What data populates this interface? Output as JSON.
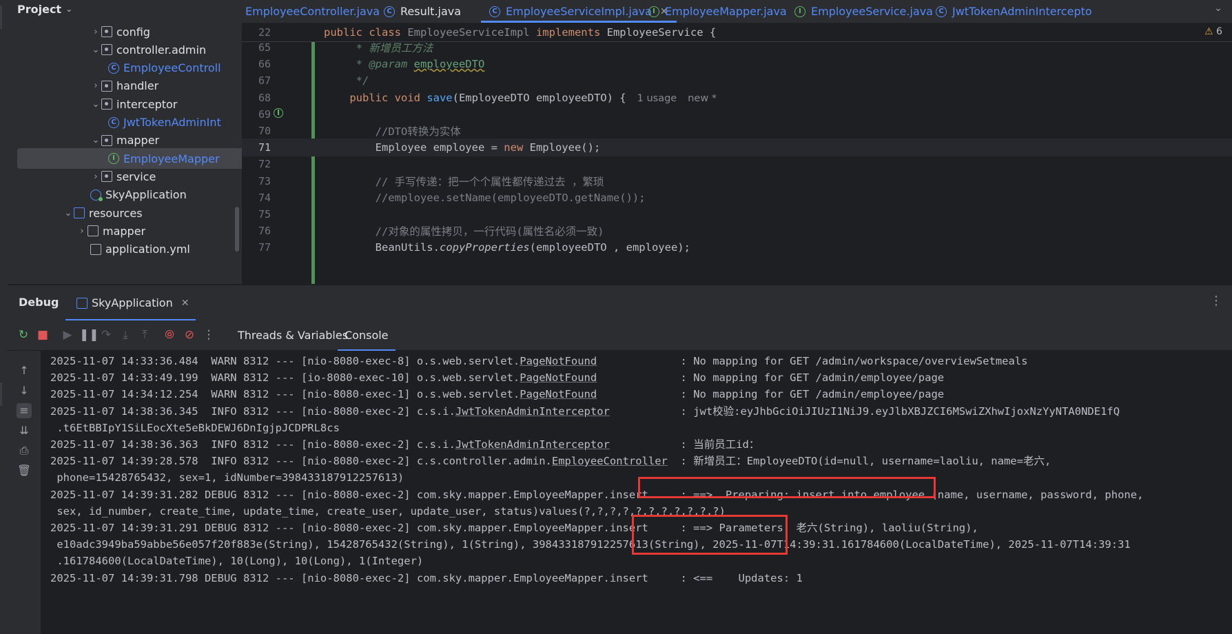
{
  "project": {
    "title": "Project",
    "tree": [
      {
        "label": "config",
        "kind": "package",
        "arrow": "right"
      },
      {
        "label": "controller.admin",
        "kind": "package",
        "arrow": "down"
      },
      {
        "label": "EmployeeControll",
        "kind": "class"
      },
      {
        "label": "handler",
        "kind": "package",
        "arrow": "right"
      },
      {
        "label": "interceptor",
        "kind": "package",
        "arrow": "down"
      },
      {
        "label": "JwtTokenAdminInt",
        "kind": "class"
      },
      {
        "label": "mapper",
        "kind": "package",
        "arrow": "down"
      },
      {
        "label": "EmployeeMapper",
        "kind": "interface",
        "selected": true
      },
      {
        "label": "service",
        "kind": "package",
        "arrow": "right"
      },
      {
        "label": "SkyApplication",
        "kind": "app"
      },
      {
        "label": "resources",
        "kind": "folder-blue",
        "arrow": "down"
      },
      {
        "label": "mapper",
        "kind": "folder",
        "arrow": "right"
      },
      {
        "label": "application.yml",
        "kind": "file"
      }
    ]
  },
  "tabs": [
    {
      "label": "EmployeeController.java",
      "kind": "class"
    },
    {
      "label": "Result.java",
      "kind": "class"
    },
    {
      "label": "EmployeeServiceImpl.java",
      "kind": "class",
      "active": true
    },
    {
      "label": "EmployeeMapper.java",
      "kind": "interface"
    },
    {
      "label": "EmployeeService.java",
      "kind": "interface"
    },
    {
      "label": "JwtTokenAdminIntercepto",
      "kind": "class"
    }
  ],
  "editor": {
    "sticky": {
      "num": "22",
      "kw1": "public class ",
      "name": "EmployeeServiceImpl",
      "kw2": " implements ",
      "iface": "EmployeeService {"
    },
    "warnings": "6",
    "lines": [
      {
        "num": "65",
        "doc": "     * 新增员工方法"
      },
      {
        "num": "66",
        "doc": "     * @param ",
        "param": "employeeDTO"
      },
      {
        "num": "67",
        "doc": "     */"
      },
      {
        "num": "68",
        "kw": "    public void ",
        "fn": "save",
        "rest": "(EmployeeDTO employeeDTO) {",
        "hint1": "1 usage",
        "hint2": "new *"
      },
      {
        "num": "69",
        "rest": ""
      },
      {
        "num": "70",
        "cm": "        //DTO转换为实体"
      },
      {
        "num": "71",
        "rest1": "        Employee employee = ",
        "kw": "new",
        "rest2": " Employee();",
        "current": true
      },
      {
        "num": "72",
        "rest": ""
      },
      {
        "num": "73",
        "cm": "        // 手写传递：把一个个属性都传递过去 ，繁琐"
      },
      {
        "num": "74",
        "cm": "        //employee.setName(employeeDTO.getName());"
      },
      {
        "num": "75",
        "rest": ""
      },
      {
        "num": "76",
        "cm": "        //对象的属性拷贝，一行代码(属性名必须一致)"
      },
      {
        "num": "77",
        "rest1": "        BeanUtils.",
        "it": "copyProperties",
        "rest2": "(employeeDTO , employee);"
      }
    ]
  },
  "debug": {
    "title": "Debug",
    "run_tab": "SkyApplication",
    "tabs": [
      "Threads & Variables",
      "Console"
    ],
    "active_tab": "Console"
  },
  "console": [
    {
      "a": "2025-11-07 14:33:36.484  WARN 8312 --- [nio-8080-exec-8] o.s.web.servlet.",
      "u": "PageNotFound",
      "b": "             : No mapping for GET /admin/workspace/overviewSetmeals"
    },
    {
      "a": "2025-11-07 14:33:49.199  WARN 8312 --- [io-8080-exec-10] o.s.web.servlet.",
      "u": "PageNotFound",
      "b": "             : No mapping for GET /admin/employee/page"
    },
    {
      "a": "2025-11-07 14:34:12.254  WARN 8312 --- [nio-8080-exec-1] o.s.web.servlet.",
      "u": "PageNotFound",
      "b": "             : No mapping for GET /admin/employee/page"
    },
    {
      "a": "2025-11-07 14:38:36.345  INFO 8312 --- [nio-8080-exec-2] c.s.i.",
      "u": "JwtTokenAdminInterceptor",
      "b": "           : jwt校验:eyJhbGciOiJIUzI1NiJ9.eyJlbXBJZCI6MSwiZXhwIjoxNzYyNTA0NDE1fQ"
    },
    {
      "a": " .t6EtBBIpY1SiLEocXte5eBkDEWJ6DnIgjpJCDPRL8cs"
    },
    {
      "a": "2025-11-07 14:38:36.363  INFO 8312 --- [nio-8080-exec-2] c.s.i.",
      "u": "JwtTokenAdminInterceptor",
      "b": "           : 当前员工id："
    },
    {
      "a": "2025-11-07 14:39:28.578  INFO 8312 --- [nio-8080-exec-2] c.s.controller.admin.",
      "u": "EmployeeController",
      "b": "  : 新增员工：EmployeeDTO(id=null, username=laoliu, name=老六,"
    },
    {
      "a": " phone=15428765432, sex=1, idNumber=398433187912257613)"
    },
    {
      "a": "2025-11-07 14:39:31.282 DEBUG 8312 --- [nio-8080-exec-2] com.sky.mapper.EmployeeMapper.insert     : ==>  Preparing: insert into employee (name, username, password, phone,"
    },
    {
      "a": " sex, id_number, create_time, update_time, create_user, update_user, status)values(?,?,?,?,?,?,?,?,?,?,?)"
    },
    {
      "a": "2025-11-07 14:39:31.291 DEBUG 8312 --- [nio-8080-exec-2] com.sky.mapper.EmployeeMapper.insert     : ==> Parameters: 老六(String), laoliu(String),"
    },
    {
      "a": " e10adc3949ba59abbe56e057f20f883e(String), 15428765432(String), 1(String), 398433187912257613(String), 2025-11-07T14:39:31.161784600(LocalDateTime), 2025-11-07T14:39:31"
    },
    {
      "a": " .161784600(LocalDateTime), 10(Long), 10(Long), 1(Integer)"
    },
    {
      "a": "2025-11-07 14:39:31.798 DEBUG 8312 --- [nio-8080-exec-2] com.sky.mapper.EmployeeMapper.insert     : <==    Updates: 1"
    }
  ],
  "colors": {
    "accent": "#548af7",
    "highlight_box": "#e53935"
  }
}
